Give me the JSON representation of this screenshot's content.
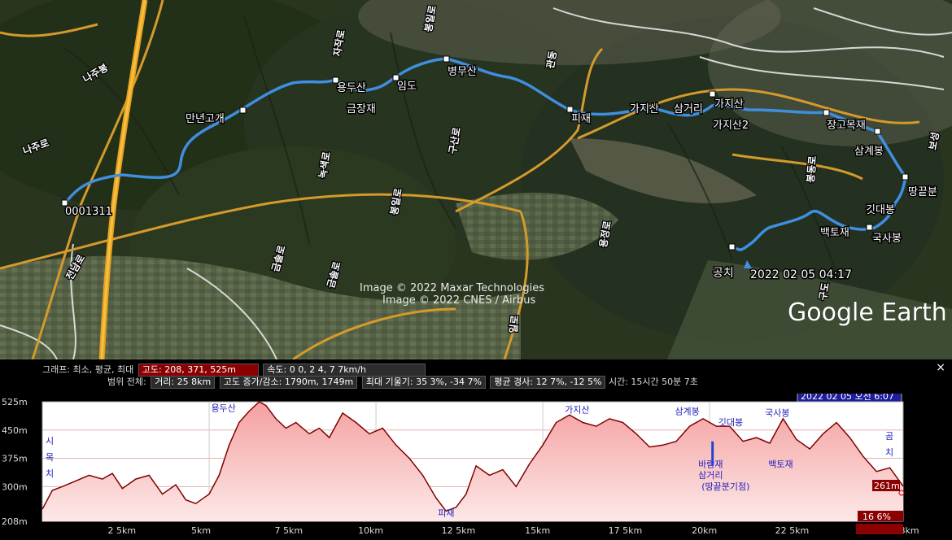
{
  "map": {
    "start_label": "0001311",
    "end_label": "공치",
    "timestamp": "2022 02 05 04:17",
    "credit_line1": "Image © 2022 Maxar Technologies",
    "credit_line2": "Image © 2022 CNES / Airbus",
    "brand": "Google Earth",
    "waypoints": [
      "만년고개",
      "용두산",
      "임도",
      "금장재",
      "병무산",
      "피재",
      "가지산",
      "삼거리",
      "가지산",
      "가지산2",
      "장고목재",
      "삼계봉",
      "땅끝분",
      "깃대봉",
      "백토재",
      "국사봉"
    ],
    "roads": [
      "나주봉",
      "나주로",
      "용두로",
      "자작로",
      "봉일로",
      "녹색로",
      "구산로",
      "봉일로",
      "금솔로",
      "금솔로",
      "전남로",
      "관동",
      "봉동로",
      "일로",
      "용정로",
      "보성",
      "구도"
    ]
  },
  "stats": {
    "line1_label": "그래프: 최소, 평균, 최대",
    "altitude": "고도: 208, 371, 525m",
    "speed": "속도: 0    0, 2    4, 7    7km/h",
    "line2_label": "범위 전체:",
    "distance": "거리: 25    8km",
    "elev_gain": "고도 증가/감소: 1790m, 1749m",
    "slope": "최대 기울기: 35    3%, -34    7%",
    "avg_slope": "평균 경사: 12    7%, -12    5%",
    "time": "시간: 15시간 50분 7초"
  },
  "close_label": "×",
  "chart_data": {
    "type": "area",
    "ylabels": [
      "525m",
      "450m",
      "375m",
      "300m",
      "208m"
    ],
    "ylim": [
      208,
      525
    ],
    "xlim": [
      0,
      25.8
    ],
    "xticks": [
      "2    5km",
      "5km",
      "7    5km",
      "10km",
      "12    5km",
      "15km",
      "17    5km",
      "20km",
      "22    5km",
      "25    8km"
    ],
    "x": [
      0,
      0.3,
      0.6,
      1.0,
      1.4,
      1.8,
      2.1,
      2.4,
      2.8,
      3.2,
      3.6,
      4.0,
      4.3,
      4.6,
      5.0,
      5.3,
      5.6,
      5.9,
      6.2,
      6.5,
      6.7,
      7.0,
      7.3,
      7.6,
      8.0,
      8.3,
      8.6,
      9.0,
      9.4,
      9.8,
      10.2,
      10.6,
      11.0,
      11.4,
      11.8,
      12.1,
      12.4,
      12.7,
      13.0,
      13.4,
      13.8,
      14.2,
      14.6,
      15.0,
      15.4,
      15.8,
      16.2,
      16.6,
      17.0,
      17.4,
      17.8,
      18.2,
      18.6,
      19.0,
      19.4,
      19.8,
      20.2,
      20.6,
      21.0,
      21.4,
      21.8,
      22.2,
      22.6,
      23.0,
      23.4,
      23.8,
      24.2,
      24.6,
      25.0,
      25.4,
      25.8
    ],
    "values": [
      240,
      290,
      300,
      315,
      330,
      320,
      335,
      295,
      320,
      330,
      280,
      305,
      265,
      255,
      280,
      330,
      410,
      470,
      500,
      525,
      515,
      480,
      455,
      470,
      440,
      455,
      430,
      495,
      470,
      440,
      455,
      410,
      375,
      330,
      270,
      235,
      245,
      280,
      355,
      330,
      345,
      300,
      360,
      410,
      470,
      490,
      470,
      460,
      480,
      470,
      440,
      405,
      410,
      420,
      460,
      480,
      460,
      460,
      420,
      430,
      415,
      480,
      425,
      400,
      440,
      470,
      430,
      380,
      340,
      350,
      301
    ],
    "series": [
      {
        "name": "고도",
        "color": "#800000"
      }
    ],
    "annotations": {
      "start": [
        "시",
        "목",
        "치"
      ],
      "end": [
        "곰",
        "치"
      ],
      "waypoints": [
        {
          "text": "용두산",
          "x": 5.4,
          "y": 500
        },
        {
          "text": "피재",
          "x": 12.2,
          "y": 222
        },
        {
          "text": "가지산",
          "x": 16.0,
          "y": 496
        },
        {
          "text": "삼계봉",
          "x": 19.3,
          "y": 492
        },
        {
          "text": "깃대봉",
          "x": 20.6,
          "y": 463
        },
        {
          "text": "국사봉",
          "x": 22.0,
          "y": 487
        },
        {
          "text": "바람재",
          "x": 20.0,
          "y": 351
        },
        {
          "text": "삼거리",
          "x": 20.0,
          "y": 322
        },
        {
          "text": "(땅끝분기점)",
          "x": 20.1,
          "y": 292
        },
        {
          "text": "백토재",
          "x": 22.1,
          "y": 351
        }
      ],
      "date": "2022 02 05 오전 6:07",
      "cursor_value": "261m",
      "cursor_slope": "16    6%",
      "cursor_dist": "25    8km"
    }
  }
}
